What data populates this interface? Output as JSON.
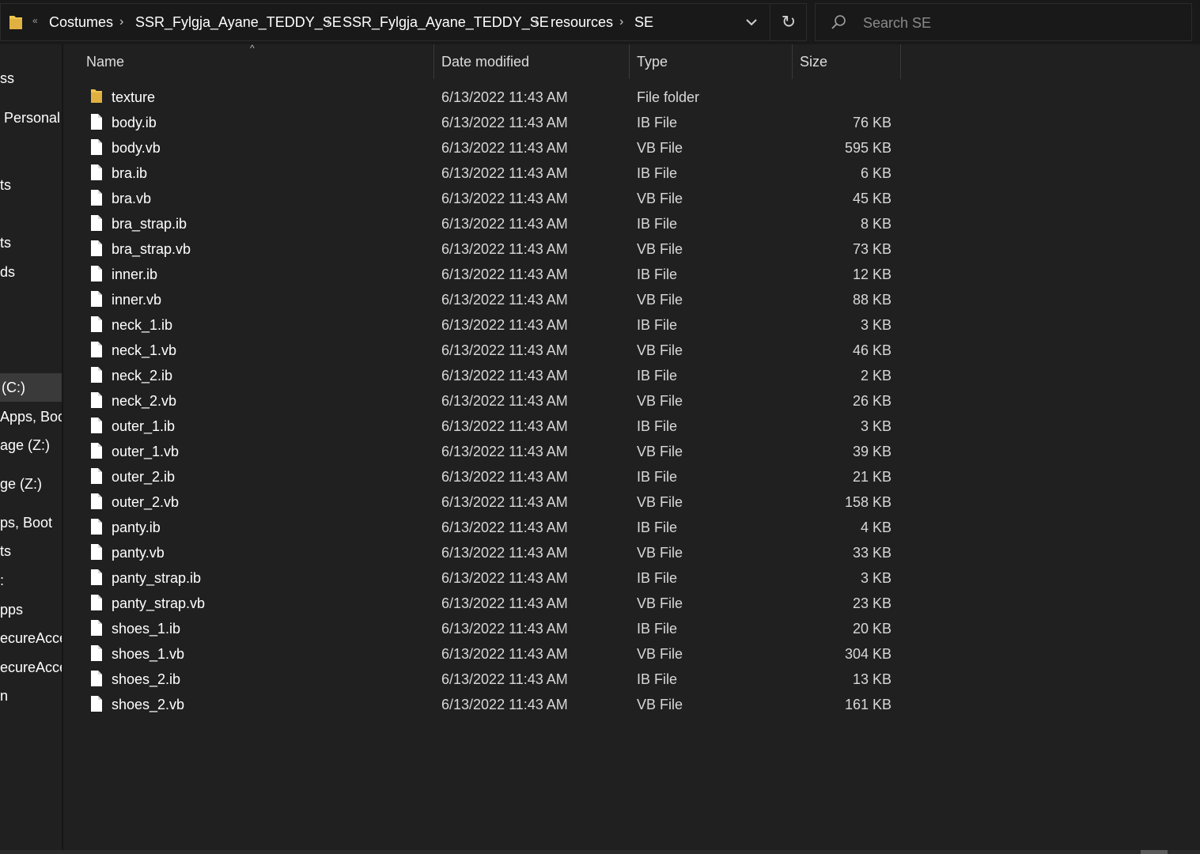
{
  "address_bar": {
    "overflow_label": "«",
    "breadcrumbs": [
      "Costumes",
      "SSR_Fylgja_Ayane_TEDDY_SE",
      "SSR_Fylgja_Ayane_TEDDY_SE",
      "resources",
      "SE"
    ],
    "separator": "›",
    "dropdown_icon": "chevron-down-icon",
    "refresh_icon": "refresh-icon",
    "refresh_glyph": "↻"
  },
  "search": {
    "placeholder": "Search SE",
    "value": "",
    "icon": "search-icon"
  },
  "nav_pane": {
    "items": [
      {
        "label": "ss"
      },
      {
        "label": "Personal"
      },
      {
        "label": "ts"
      },
      {
        "label": "ts"
      },
      {
        "label": "ds"
      },
      {
        "label": "(C:)",
        "selected": true
      },
      {
        "label": "Apps, Boo"
      },
      {
        "label": "age (Z:)"
      },
      {
        "label": "ge (Z:)"
      },
      {
        "label": "ps, Boot"
      },
      {
        "label": "ts"
      },
      {
        "label": ":"
      },
      {
        "label": "pps"
      },
      {
        "label": "ecureAcce"
      },
      {
        "label": "ecureAcce"
      },
      {
        "label": "n"
      }
    ]
  },
  "columns": {
    "name": "Name",
    "date_modified": "Date modified",
    "type": "Type",
    "size": "Size",
    "sort_indicator": "^"
  },
  "files": [
    {
      "name": "texture",
      "date": "6/13/2022 11:43 AM",
      "type": "File folder",
      "size": "",
      "icon": "folder-icon"
    },
    {
      "name": "body.ib",
      "date": "6/13/2022 11:43 AM",
      "type": "IB File",
      "size": "76 KB",
      "icon": "file-icon"
    },
    {
      "name": "body.vb",
      "date": "6/13/2022 11:43 AM",
      "type": "VB File",
      "size": "595 KB",
      "icon": "file-icon"
    },
    {
      "name": "bra.ib",
      "date": "6/13/2022 11:43 AM",
      "type": "IB File",
      "size": "6 KB",
      "icon": "file-icon"
    },
    {
      "name": "bra.vb",
      "date": "6/13/2022 11:43 AM",
      "type": "VB File",
      "size": "45 KB",
      "icon": "file-icon"
    },
    {
      "name": "bra_strap.ib",
      "date": "6/13/2022 11:43 AM",
      "type": "IB File",
      "size": "8 KB",
      "icon": "file-icon"
    },
    {
      "name": "bra_strap.vb",
      "date": "6/13/2022 11:43 AM",
      "type": "VB File",
      "size": "73 KB",
      "icon": "file-icon"
    },
    {
      "name": "inner.ib",
      "date": "6/13/2022 11:43 AM",
      "type": "IB File",
      "size": "12 KB",
      "icon": "file-icon"
    },
    {
      "name": "inner.vb",
      "date": "6/13/2022 11:43 AM",
      "type": "VB File",
      "size": "88 KB",
      "icon": "file-icon"
    },
    {
      "name": "neck_1.ib",
      "date": "6/13/2022 11:43 AM",
      "type": "IB File",
      "size": "3 KB",
      "icon": "file-icon"
    },
    {
      "name": "neck_1.vb",
      "date": "6/13/2022 11:43 AM",
      "type": "VB File",
      "size": "46 KB",
      "icon": "file-icon"
    },
    {
      "name": "neck_2.ib",
      "date": "6/13/2022 11:43 AM",
      "type": "IB File",
      "size": "2 KB",
      "icon": "file-icon"
    },
    {
      "name": "neck_2.vb",
      "date": "6/13/2022 11:43 AM",
      "type": "VB File",
      "size": "26 KB",
      "icon": "file-icon"
    },
    {
      "name": "outer_1.ib",
      "date": "6/13/2022 11:43 AM",
      "type": "IB File",
      "size": "3 KB",
      "icon": "file-icon"
    },
    {
      "name": "outer_1.vb",
      "date": "6/13/2022 11:43 AM",
      "type": "VB File",
      "size": "39 KB",
      "icon": "file-icon"
    },
    {
      "name": "outer_2.ib",
      "date": "6/13/2022 11:43 AM",
      "type": "IB File",
      "size": "21 KB",
      "icon": "file-icon"
    },
    {
      "name": "outer_2.vb",
      "date": "6/13/2022 11:43 AM",
      "type": "VB File",
      "size": "158 KB",
      "icon": "file-icon"
    },
    {
      "name": "panty.ib",
      "date": "6/13/2022 11:43 AM",
      "type": "IB File",
      "size": "4 KB",
      "icon": "file-icon"
    },
    {
      "name": "panty.vb",
      "date": "6/13/2022 11:43 AM",
      "type": "VB File",
      "size": "33 KB",
      "icon": "file-icon"
    },
    {
      "name": "panty_strap.ib",
      "date": "6/13/2022 11:43 AM",
      "type": "IB File",
      "size": "3 KB",
      "icon": "file-icon"
    },
    {
      "name": "panty_strap.vb",
      "date": "6/13/2022 11:43 AM",
      "type": "VB File",
      "size": "23 KB",
      "icon": "file-icon"
    },
    {
      "name": "shoes_1.ib",
      "date": "6/13/2022 11:43 AM",
      "type": "IB File",
      "size": "20 KB",
      "icon": "file-icon"
    },
    {
      "name": "shoes_1.vb",
      "date": "6/13/2022 11:43 AM",
      "type": "VB File",
      "size": "304 KB",
      "icon": "file-icon"
    },
    {
      "name": "shoes_2.ib",
      "date": "6/13/2022 11:43 AM",
      "type": "IB File",
      "size": "13 KB",
      "icon": "file-icon"
    },
    {
      "name": "shoes_2.vb",
      "date": "6/13/2022 11:43 AM",
      "type": "VB File",
      "size": "161 KB",
      "icon": "file-icon"
    }
  ],
  "colors": {
    "background": "#191919",
    "pane": "#202020",
    "folder": "#f0c44c",
    "text": "#ffffff",
    "selection": "#3a3a3a"
  }
}
